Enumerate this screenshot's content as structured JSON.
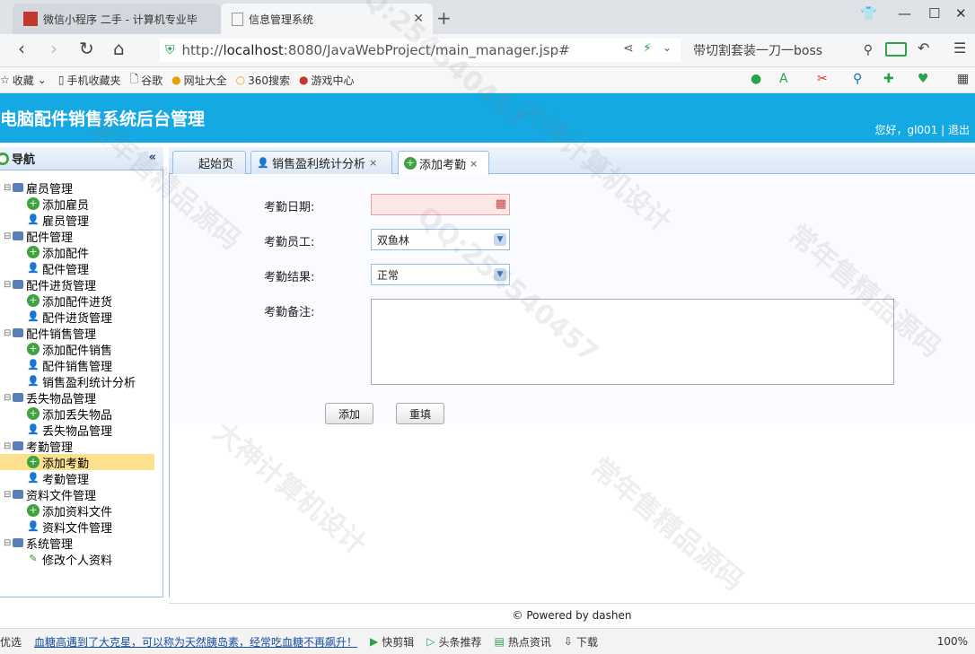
{
  "browser": {
    "tabs": [
      {
        "label": "微信小程序 二手 - 计算机专业毕"
      },
      {
        "label": "信息管理系统"
      }
    ],
    "url_prefix": "http://",
    "url_host": "localhost",
    "url_rest": ":8080/JavaWebProject/main_manager.jsp#",
    "search_text": "带切割套装一刀一boss",
    "bookmarks": [
      "收藏",
      "手机收藏夹",
      "谷歌",
      "网址大全",
      "360搜索",
      "游戏中心"
    ]
  },
  "app": {
    "title": "电脑配件销售系统后台管理",
    "user_greeting": "您好，gl001 | 退出"
  },
  "sidebar": {
    "title": "导航",
    "groups": [
      {
        "label": "雇员管理",
        "items": [
          "添加雇员",
          "雇员管理"
        ]
      },
      {
        "label": "配件管理",
        "items": [
          "添加配件",
          "配件管理"
        ]
      },
      {
        "label": "配件进货管理",
        "items": [
          "添加配件进货",
          "配件进货管理"
        ]
      },
      {
        "label": "配件销售管理",
        "items": [
          "添加配件销售",
          "配件销售管理",
          "销售盈利统计分析"
        ]
      },
      {
        "label": "丢失物品管理",
        "items": [
          "添加丢失物品",
          "丢失物品管理"
        ]
      },
      {
        "label": "考勤管理",
        "items": [
          "添加考勤",
          "考勤管理"
        ]
      },
      {
        "label": "资料文件管理",
        "items": [
          "添加资料文件",
          "资料文件管理"
        ]
      },
      {
        "label": "系统管理",
        "items": [
          "修改个人资料"
        ]
      }
    ]
  },
  "tabs": [
    {
      "label": "起始页"
    },
    {
      "label": "销售盈利统计分析"
    },
    {
      "label": "添加考勤"
    }
  ],
  "form": {
    "date_label": "考勤日期:",
    "date_value": "",
    "employee_label": "考勤员工:",
    "employee_value": "双鱼林",
    "result_label": "考勤结果:",
    "result_value": "正常",
    "notes_label": "考勤备注:",
    "notes_value": "",
    "add_button": "添加",
    "reset_button": "重填"
  },
  "footer": "© Powered by dashen",
  "statusbar": {
    "items": [
      "优选",
      "血糖高遇到了大克星，可以称为天然胰岛素，经常吃血糖不再飙升！",
      "快剪辑",
      "头条推荐",
      "热点资讯",
      "下载",
      "100%"
    ]
  },
  "watermark": [
    "QQ:254540457",
    "常年售精品源码",
    "大神计算机设计"
  ]
}
